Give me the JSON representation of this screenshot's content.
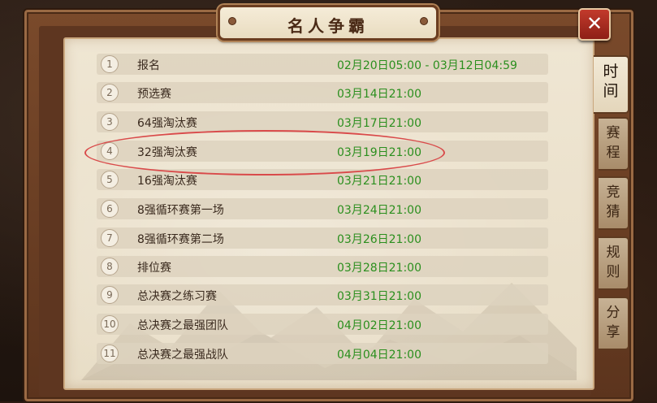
{
  "title": "名人争霸",
  "close_label": "✕",
  "schedule": [
    {
      "num": "1",
      "name": "报名",
      "time": "02月20日05:00 - 03月12日04:59"
    },
    {
      "num": "2",
      "name": "预选赛",
      "time": "03月14日21:00"
    },
    {
      "num": "3",
      "name": "64强淘汰赛",
      "time": "03月17日21:00"
    },
    {
      "num": "4",
      "name": "32强淘汰赛",
      "time": "03月19日21:00"
    },
    {
      "num": "5",
      "name": "16强淘汰赛",
      "time": "03月21日21:00"
    },
    {
      "num": "6",
      "name": "8强循环赛第一场",
      "time": "03月24日21:00"
    },
    {
      "num": "7",
      "name": "8强循环赛第二场",
      "time": "03月26日21:00"
    },
    {
      "num": "8",
      "name": "排位赛",
      "time": "03月28日21:00"
    },
    {
      "num": "9",
      "name": "总决赛之练习赛",
      "time": "03月31日21:00"
    },
    {
      "num": "10",
      "name": "总决赛之最强团队",
      "time": "04月02日21:00"
    },
    {
      "num": "11",
      "name": "总决赛之最强战队",
      "time": "04月04日21:00"
    }
  ],
  "tabs": [
    {
      "label_top": "时",
      "label_bottom": "间",
      "active": true
    },
    {
      "label_top": "赛",
      "label_bottom": "程",
      "active": false
    },
    {
      "label_top": "竞",
      "label_bottom": "猜",
      "active": false
    },
    {
      "label_top": "规",
      "label_bottom": "则",
      "active": false
    },
    {
      "label_top": "分",
      "label_bottom": "享",
      "active": false
    }
  ],
  "colors": {
    "time_text": "#2b8f1e",
    "highlight_ring": "#d94a4a",
    "close_button": "#c23a2c",
    "parchment": "#efe6d3"
  }
}
